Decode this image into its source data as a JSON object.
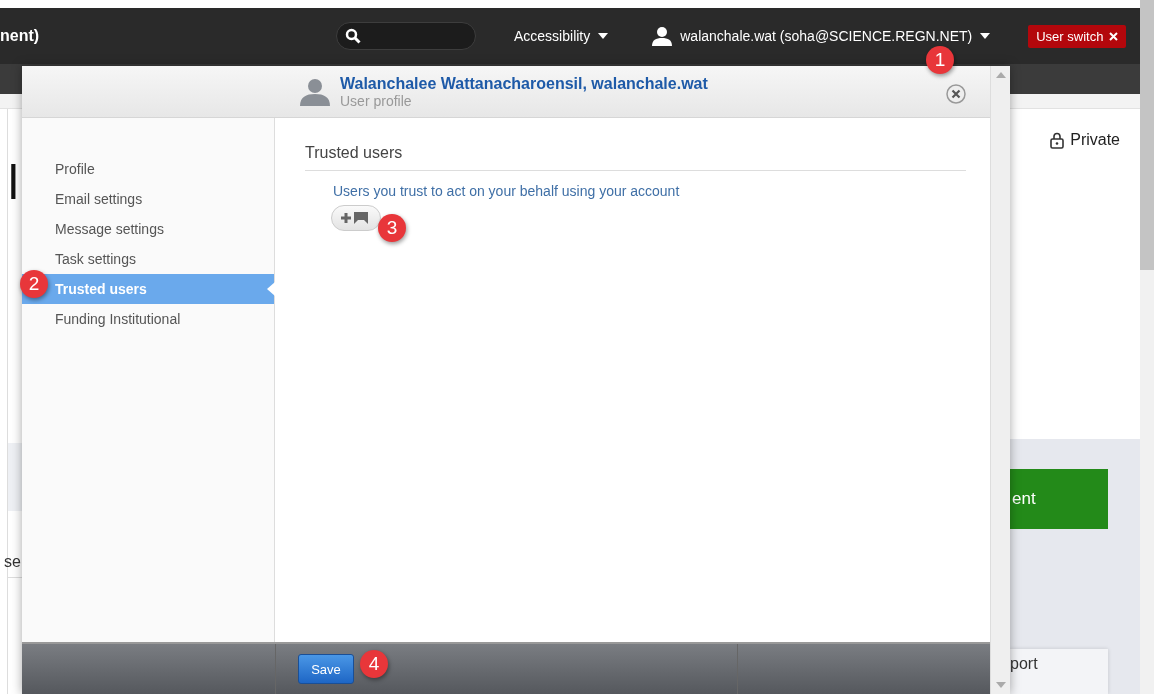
{
  "top_bar": {
    "brand_fragment": "nent)",
    "accessibility_menu": "Accessibility",
    "user_menu": "walanchale.wat (soha@SCIENCE.REGN.NET)",
    "user_switch": "User switch"
  },
  "page": {
    "heading_fragment": "l",
    "privacy": "Private",
    "action_button": "ent",
    "side_text": "se",
    "card_text": "port"
  },
  "dialog": {
    "title": "Walanchalee Wattanacharoensil, walanchale.wat",
    "subtitle": "User profile",
    "nav": [
      {
        "label": "Profile",
        "selected": false
      },
      {
        "label": "Email settings",
        "selected": false
      },
      {
        "label": "Message settings",
        "selected": false
      },
      {
        "label": "Task settings",
        "selected": false
      },
      {
        "label": "Trusted users",
        "selected": true
      },
      {
        "label": "Funding Institutional",
        "selected": false
      }
    ],
    "section_title": "Trusted users",
    "description": "Users you trust to act on your behalf using your account",
    "save": "Save"
  },
  "callouts": [
    "1",
    "2",
    "3",
    "4"
  ]
}
